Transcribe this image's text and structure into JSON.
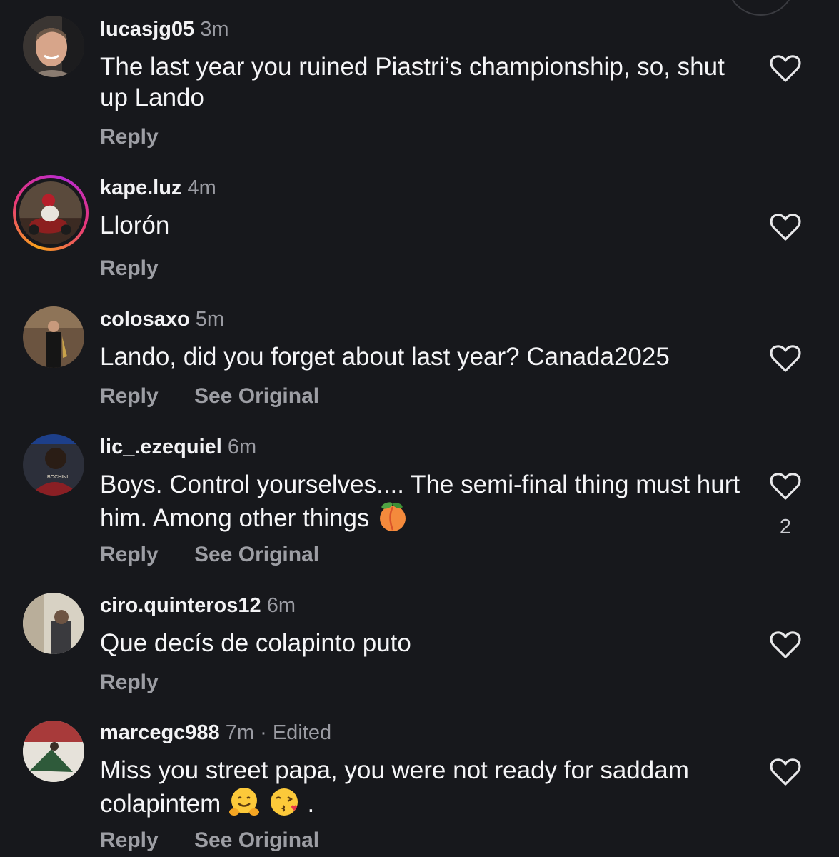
{
  "comments": [
    {
      "username": "lucasjg05",
      "time": "3m",
      "text": "The last year you ruined Piastri’s championship, so, shut up Lando",
      "actions": {
        "reply": "Reply"
      }
    },
    {
      "username": "kape.luz",
      "time": "4m",
      "text": "Llorón",
      "actions": {
        "reply": "Reply"
      }
    },
    {
      "username": "colosaxo",
      "time": "5m",
      "text": "Lando, did you forget about last year? Canada2025",
      "actions": {
        "reply": "Reply",
        "see_original": "See Original"
      }
    },
    {
      "username": "lic_.ezequiel",
      "time": "6m",
      "text": "Boys. Control yourselves.... The semi-final thing must hurt him. Among other things",
      "emojis": [
        "peach"
      ],
      "like_count": "2",
      "actions": {
        "reply": "Reply",
        "see_original": "See Original"
      }
    },
    {
      "username": "ciro.quinteros12",
      "time": "6m",
      "text": "Que decís de colapinto puto",
      "actions": {
        "reply": "Reply"
      }
    },
    {
      "username": "marcegc988",
      "time": "7m",
      "separator": "·",
      "edited": "Edited",
      "text": "Miss you street papa, you were not ready for saddam colapintem",
      "emojis": [
        "hugging-face",
        "face-blowing-kiss"
      ],
      "trailing_text": ".",
      "actions": {
        "reply": "Reply",
        "see_original": "See Original"
      }
    }
  ],
  "icons": {
    "like": "heart-outline-icon"
  },
  "colors": {
    "background": "#17181c",
    "primary_text": "#f5f5f7",
    "secondary_text": "#9d9ea4",
    "story_ring_start": "#f9a21b",
    "story_ring_end": "#b92bd1"
  }
}
